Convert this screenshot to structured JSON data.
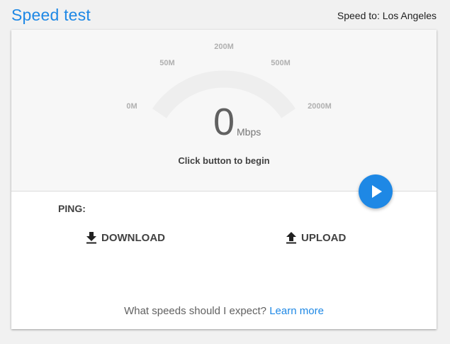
{
  "header": {
    "title": "Speed test",
    "speed_to": "Speed to: Los Angeles"
  },
  "gauge": {
    "ticks": [
      "0M",
      "50M",
      "200M",
      "500M",
      "2000M"
    ],
    "value": "0",
    "unit": "Mbps",
    "level": 0,
    "status": "Click button to begin"
  },
  "results": {
    "ping_label": "PING:",
    "download_label": "DOWNLOAD",
    "upload_label": "UPLOAD"
  },
  "footer": {
    "question": "What speeds should I expect?",
    "link": "Learn more"
  },
  "icons": {
    "play": "play-icon",
    "download": "download-icon",
    "upload": "upload-icon"
  },
  "colors": {
    "accent": "#1e88e5",
    "gauge_track": "#eeeeee",
    "panel_bg": "#f7f7f7",
    "page_bg": "#f1f1f1"
  }
}
